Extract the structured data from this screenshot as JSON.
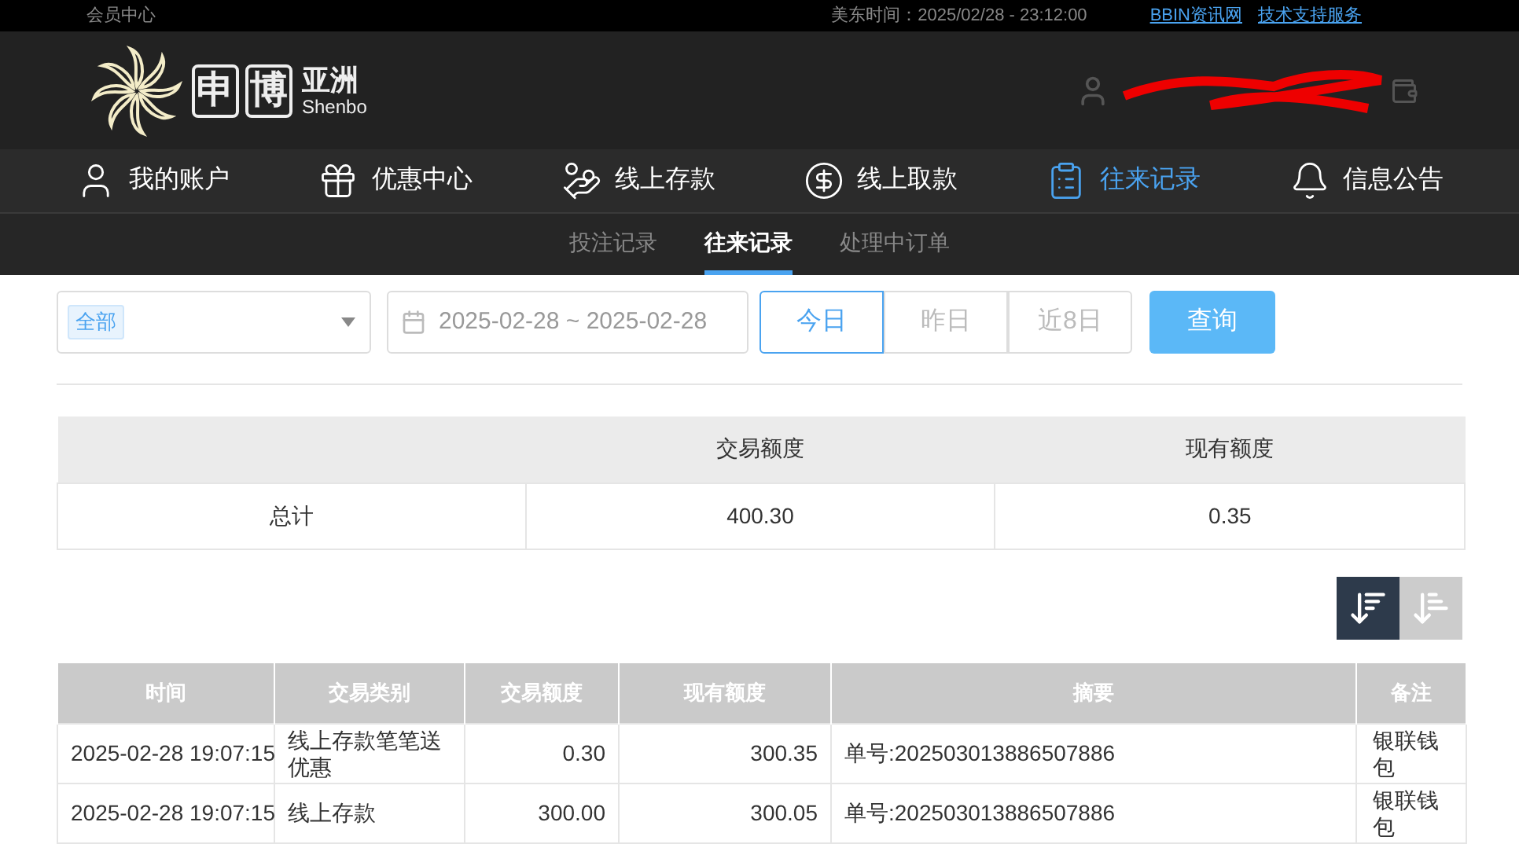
{
  "top_bar": {
    "member_center": "会员中心",
    "time": "美东时间：2025/02/28 - 23:12:00",
    "links": [
      "BBIN资讯网",
      "技术支持服务"
    ]
  },
  "logo": {
    "chars": [
      "申",
      "博"
    ],
    "region": "亚洲",
    "latin": "Shenbo"
  },
  "nav": [
    {
      "label": "我的账户",
      "kind": "account",
      "selected": false
    },
    {
      "label": "优惠中心",
      "kind": "promo",
      "selected": false
    },
    {
      "label": "线上存款",
      "kind": "deposit",
      "selected": false
    },
    {
      "label": "线上取款",
      "kind": "withdraw",
      "selected": false
    },
    {
      "label": "往来记录",
      "kind": "records",
      "selected": true
    },
    {
      "label": "信息公告",
      "kind": "notice",
      "selected": false
    }
  ],
  "sub_tabs": [
    {
      "label": "投注记录",
      "selected": false
    },
    {
      "label": "往来记录",
      "selected": true
    },
    {
      "label": "处理中订单",
      "selected": false
    }
  ],
  "filter": {
    "type_tag": "全部",
    "date_range": "2025-02-28 ~ 2025-02-28",
    "quick_ranges": [
      {
        "label": "今日",
        "selected": true
      },
      {
        "label": "昨日",
        "selected": false
      },
      {
        "label": "近8日",
        "selected": false
      }
    ],
    "query_button": "查询"
  },
  "summary": {
    "columns": [
      "",
      "交易额度",
      "现有额度"
    ],
    "rows": [
      [
        "总计",
        "400.30",
        "0.35"
      ]
    ]
  },
  "sort_buttons": [
    {
      "kind": "desc",
      "selected": true
    },
    {
      "kind": "asc",
      "selected": false
    }
  ],
  "table": {
    "columns": [
      "时间",
      "交易类别",
      "交易额度",
      "现有额度",
      "摘要",
      "备注"
    ],
    "rows": [
      [
        "2025-02-28 19:07:15",
        "线上存款笔笔送优惠",
        "0.30",
        "300.35",
        "单号:202503013886507886",
        "银联钱包"
      ],
      [
        "2025-02-28 19:07:15",
        "线上存款",
        "300.00",
        "300.05",
        "单号:202503013886507886",
        "银联钱包"
      ]
    ]
  }
}
